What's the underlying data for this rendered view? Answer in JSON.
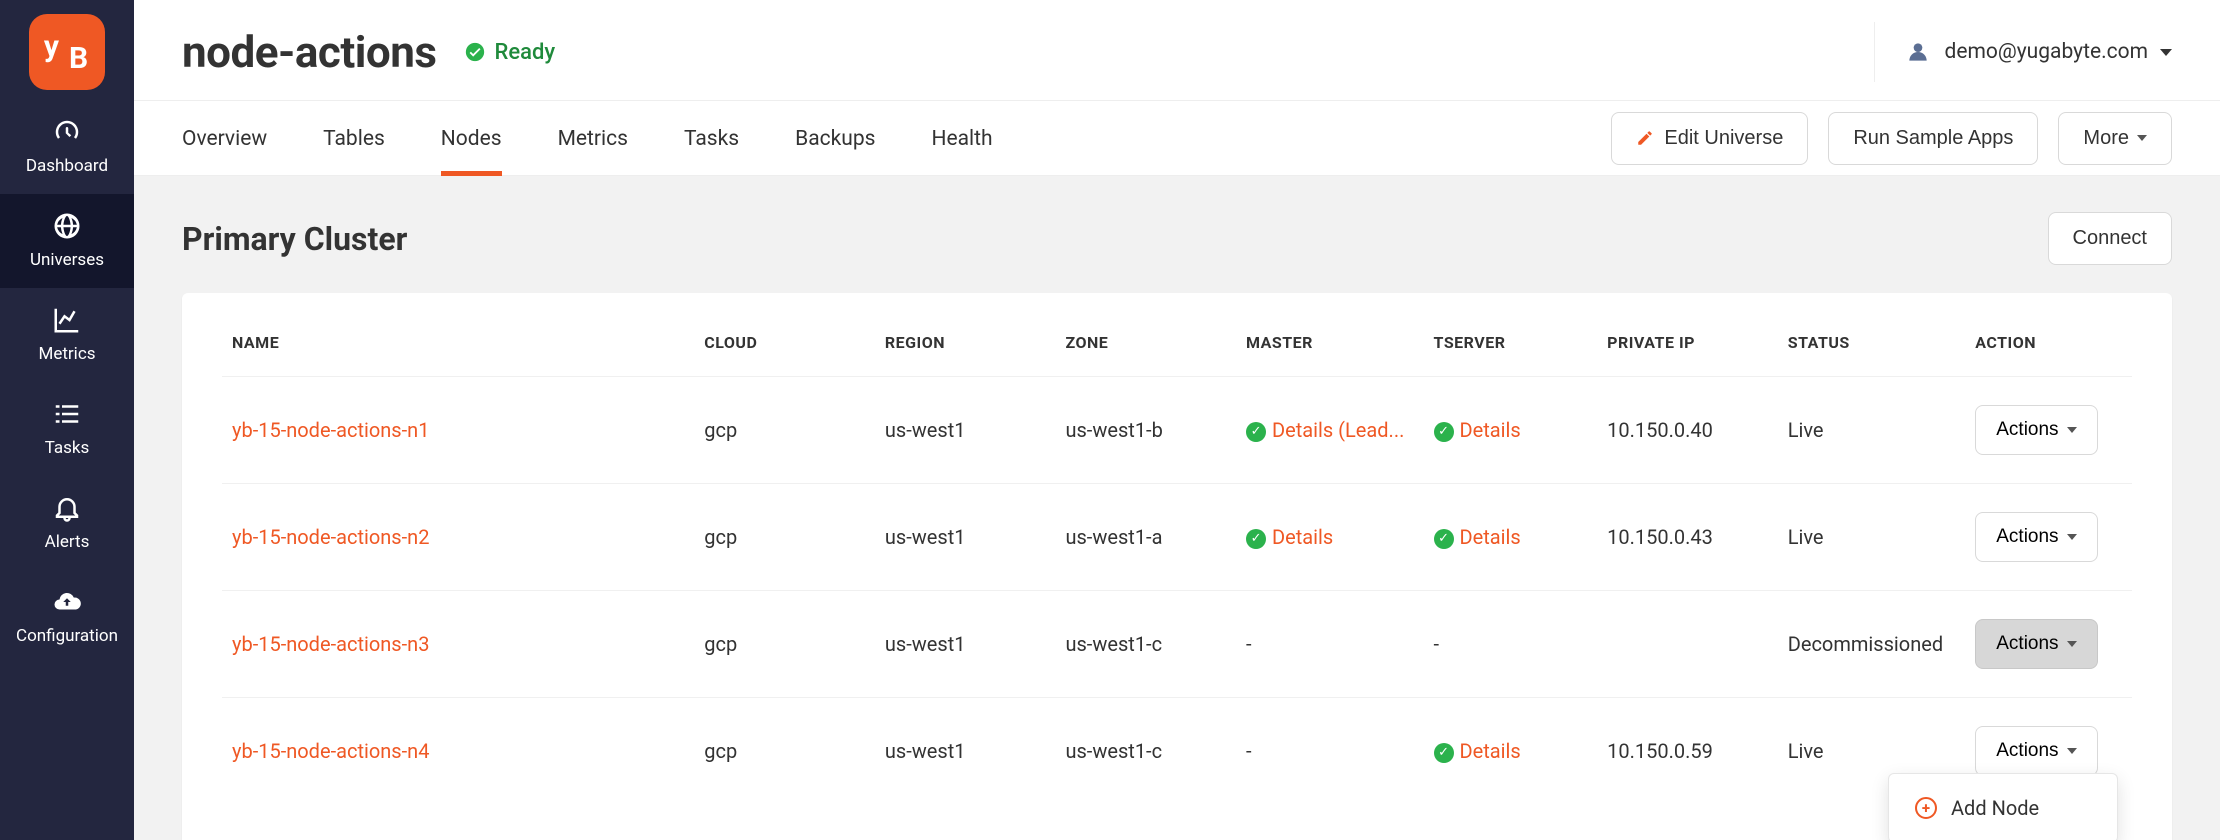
{
  "sidebar": {
    "items": [
      {
        "label": "Dashboard"
      },
      {
        "label": "Universes"
      },
      {
        "label": "Metrics"
      },
      {
        "label": "Tasks"
      },
      {
        "label": "Alerts"
      },
      {
        "label": "Configuration"
      }
    ]
  },
  "header": {
    "title": "node-actions",
    "status": "Ready",
    "user_email": "demo@yugabyte.com"
  },
  "tabs": [
    {
      "label": "Overview"
    },
    {
      "label": "Tables"
    },
    {
      "label": "Nodes"
    },
    {
      "label": "Metrics"
    },
    {
      "label": "Tasks"
    },
    {
      "label": "Backups"
    },
    {
      "label": "Health"
    }
  ],
  "tabbar_buttons": {
    "edit": "Edit Universe",
    "sample": "Run Sample Apps",
    "more": "More"
  },
  "cluster": {
    "title": "Primary Cluster",
    "connect": "Connect"
  },
  "columns": {
    "name": "NAME",
    "cloud": "CLOUD",
    "region": "REGION",
    "zone": "ZONE",
    "master": "MASTER",
    "tserver": "TSERVER",
    "ip": "PRIVATE IP",
    "status": "STATUS",
    "action": "ACTION"
  },
  "rows": [
    {
      "name": "yb-15-node-actions-n1",
      "cloud": "gcp",
      "region": "us-west1",
      "zone": "us-west1-b",
      "master": "Details (Lead...",
      "master_ok": true,
      "tserver": "Details",
      "tserver_ok": true,
      "ip": "10.150.0.40",
      "status": "Live",
      "action": "Actions"
    },
    {
      "name": "yb-15-node-actions-n2",
      "cloud": "gcp",
      "region": "us-west1",
      "zone": "us-west1-a",
      "master": "Details",
      "master_ok": true,
      "tserver": "Details",
      "tserver_ok": true,
      "ip": "10.150.0.43",
      "status": "Live",
      "action": "Actions"
    },
    {
      "name": "yb-15-node-actions-n3",
      "cloud": "gcp",
      "region": "us-west1",
      "zone": "us-west1-c",
      "master": "-",
      "master_ok": false,
      "tserver": "-",
      "tserver_ok": false,
      "ip": "",
      "status": "Decommissioned",
      "action": "Actions"
    },
    {
      "name": "yb-15-node-actions-n4",
      "cloud": "gcp",
      "region": "us-west1",
      "zone": "us-west1-c",
      "master": "-",
      "master_ok": false,
      "tserver": "Details",
      "tserver_ok": true,
      "ip": "10.150.0.59",
      "status": "Live",
      "action": "Actions"
    }
  ],
  "dropdown": {
    "add_node": "Add Node"
  }
}
